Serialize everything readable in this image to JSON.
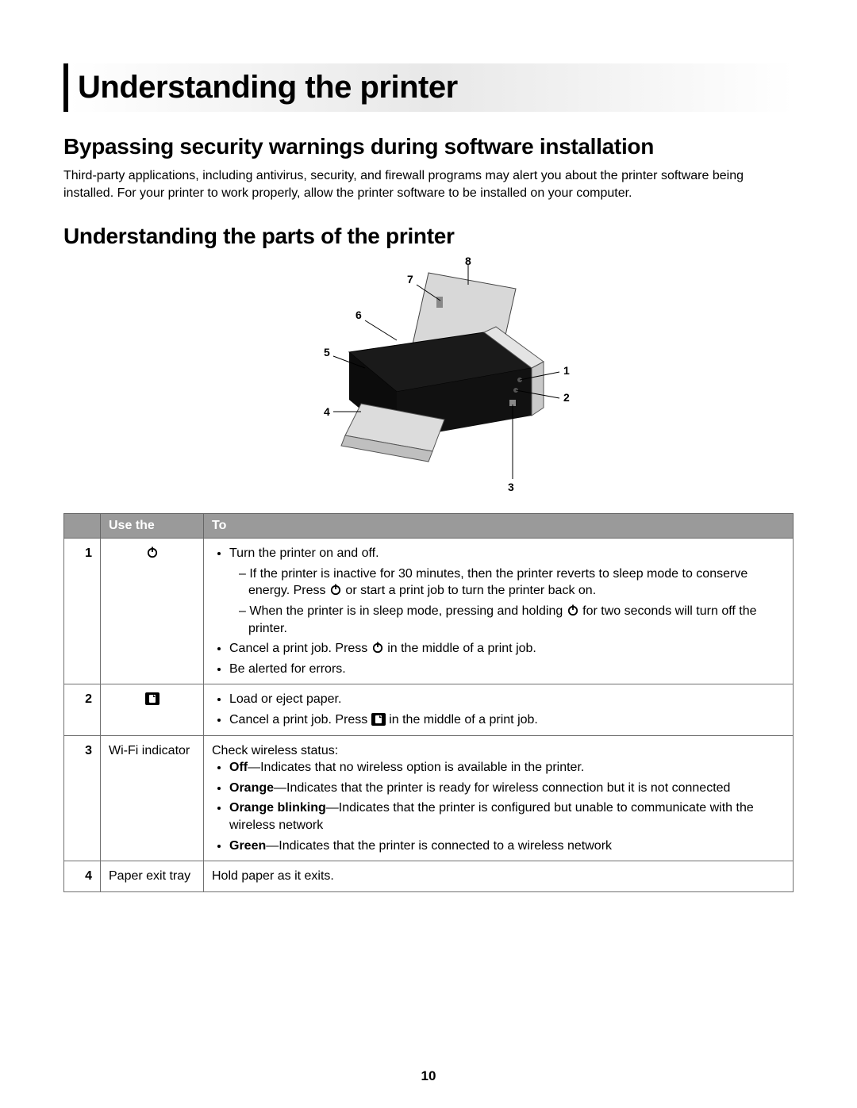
{
  "chapter_title": "Understanding the printer",
  "section_bypass": {
    "heading": "Bypassing security warnings during software installation",
    "body": "Third-party applications, including antivirus, security, and firewall programs may alert you about the printer software being installed. For your printer to work properly, allow the printer software to be installed on your computer."
  },
  "section_parts": {
    "heading": "Understanding the parts of the printer"
  },
  "diagram": {
    "callouts": [
      "1",
      "2",
      "3",
      "4",
      "5",
      "6",
      "7",
      "8"
    ]
  },
  "table": {
    "headers": {
      "col1": "",
      "col2": "Use the",
      "col3": "To"
    },
    "rows": [
      {
        "num": "1",
        "use_icon": "power-icon",
        "to": {
          "lead": null,
          "bullets": [
            {
              "text": "Turn the printer on and off.",
              "sub": [
                {
                  "pre": "If the printer is inactive for 30 minutes, then the printer reverts to sleep mode to conserve energy. Press ",
                  "icon": "power-icon",
                  "post": " or start a print job to turn the printer back on."
                },
                {
                  "pre": "When the printer is in sleep mode, pressing and holding ",
                  "icon": "power-icon",
                  "post": " for two seconds will turn off the printer."
                }
              ]
            },
            {
              "pre": "Cancel a print job. Press ",
              "icon": "power-icon",
              "post": " in the middle of a print job."
            },
            {
              "text": "Be alerted for errors."
            }
          ]
        }
      },
      {
        "num": "2",
        "use_icon": "paper-feed-icon",
        "to": {
          "bullets": [
            {
              "text": "Load or eject paper."
            },
            {
              "pre": "Cancel a print job. Press ",
              "icon": "paper-feed-icon",
              "post": " in the middle of a print job."
            }
          ]
        }
      },
      {
        "num": "3",
        "use_text": "Wi-Fi indicator",
        "to": {
          "lead": "Check wireless status:",
          "bullets": [
            {
              "bold": "Off",
              "rest": "—Indicates that no wireless option is available in the printer."
            },
            {
              "bold": "Orange",
              "rest": "—Indicates that the printer is ready for wireless connection but it is not connected"
            },
            {
              "bold": "Orange blinking",
              "rest": "—Indicates that the printer is configured but unable to communicate with the wireless network"
            },
            {
              "bold": "Green",
              "rest": "—Indicates that the printer is connected to a wireless network"
            }
          ]
        }
      },
      {
        "num": "4",
        "use_text": "Paper exit tray",
        "to": {
          "plain": "Hold paper as it exits."
        }
      }
    ]
  },
  "page_number": "10"
}
